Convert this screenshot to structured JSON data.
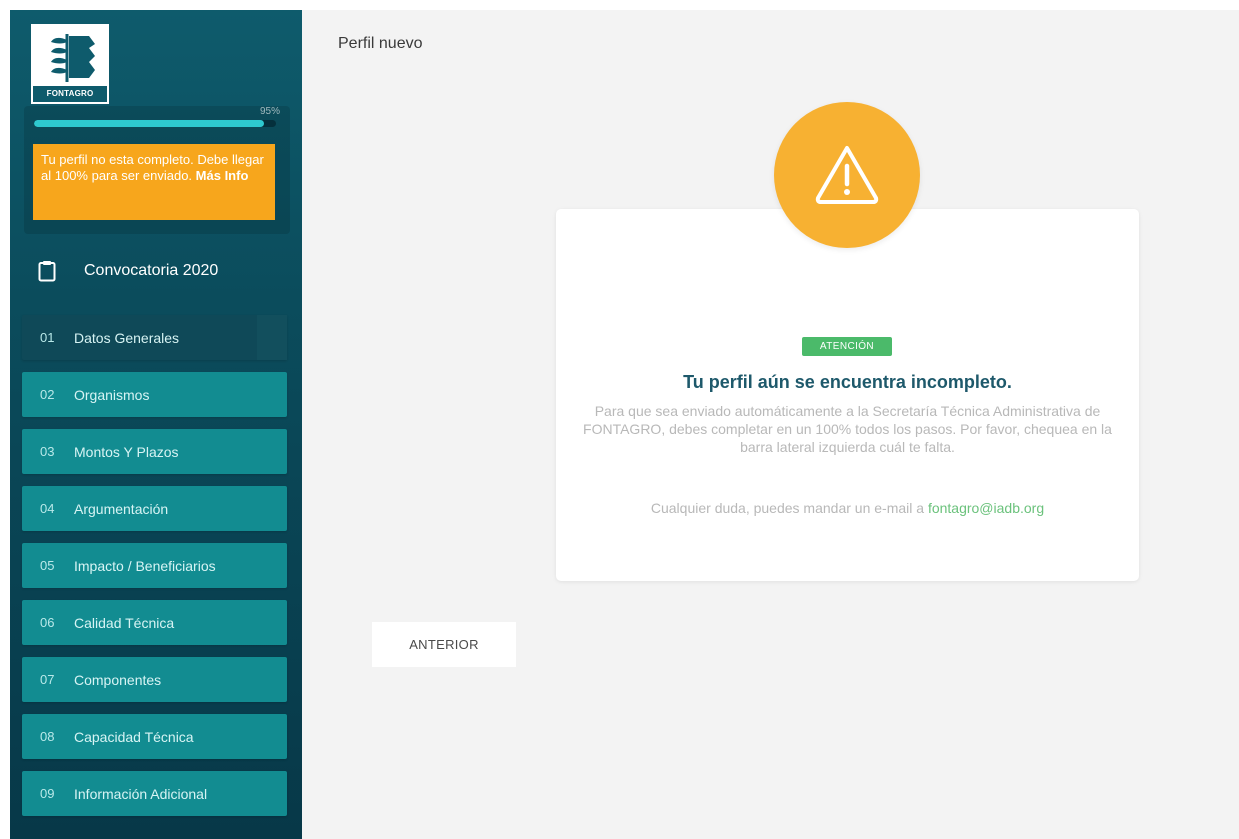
{
  "brand": {
    "logo_text": "FONTAGRO"
  },
  "sidebar": {
    "progress_percent": 95,
    "progress_label": "95%",
    "warning_text": "Tu perfil no esta completo. Debe llegar al 100% para ser enviado.",
    "warning_link": "Más Info",
    "convocatoria_label": "Convocatoria 2020",
    "steps": [
      {
        "num": "01",
        "label": "Datos Generales"
      },
      {
        "num": "02",
        "label": "Organismos"
      },
      {
        "num": "03",
        "label": "Montos Y Plazos"
      },
      {
        "num": "04",
        "label": "Argumentación"
      },
      {
        "num": "05",
        "label": "Impacto / Beneficiarios"
      },
      {
        "num": "06",
        "label": "Calidad Técnica"
      },
      {
        "num": "07",
        "label": "Componentes"
      },
      {
        "num": "08",
        "label": "Capacidad Técnica"
      },
      {
        "num": "09",
        "label": "Información Adicional"
      }
    ]
  },
  "main": {
    "page_title": "Perfil nuevo",
    "card": {
      "badge": "ATENCIÓN",
      "title": "Tu perfil aún se encuentra incompleto.",
      "body": "Para que sea enviado automáticamente a la Secretaría Técnica Administrativa de FONTAGRO, debes completar en un 100% todos los pasos. Por favor, chequea en la barra lateral izquierda cuál te falta.",
      "contact_prefix": "Cualquier duda, puedes mandar un e-mail a",
      "contact_email": "fontagro@iadb.org"
    },
    "prev_button": "ANTERIOR"
  },
  "colors": {
    "sidebar_bg": "#0b4c5c",
    "step_bg": "#128c91",
    "warning": "#f7a61c",
    "alert": "#f7b132",
    "badge": "#4bba6a",
    "title": "#1e596b"
  },
  "icons": {
    "convocatoria": "clipboard-icon",
    "alert": "warning-triangle-icon"
  }
}
